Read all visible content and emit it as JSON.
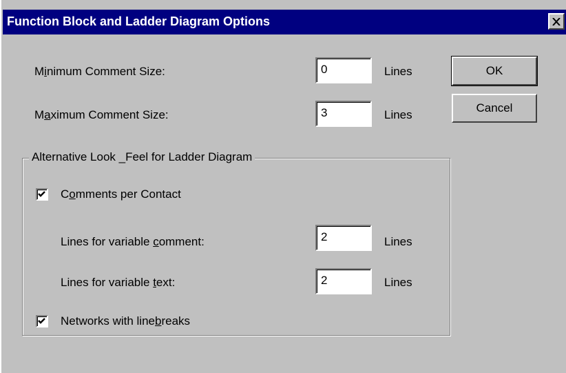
{
  "window": {
    "title": "Function Block and Ladder Diagram Options",
    "close_glyph": "close-icon"
  },
  "comment_size": {
    "min_label_pre": "M",
    "min_label_u": "i",
    "min_label_post": "nimum Comment Size:",
    "min_value": "0",
    "max_label_pre": "M",
    "max_label_u": "a",
    "max_label_post": "ximum Comment Size:",
    "max_value": "3",
    "unit": "Lines"
  },
  "buttons": {
    "ok": "OK",
    "cancel": "Cancel"
  },
  "group": {
    "title": "Alternative Look _Feel for Ladder Diagram",
    "comments_per_contact": {
      "label_pre": "C",
      "label_u": "o",
      "label_post": "mments per Contact",
      "checked": true
    },
    "var_comment": {
      "label_pre": "Lines for variable ",
      "label_u": "c",
      "label_post": "omment:",
      "value": "2",
      "unit": "Lines"
    },
    "var_text": {
      "label_pre": "Lines for variable ",
      "label_u": "t",
      "label_post": "ext:",
      "value": "2",
      "unit": "Lines"
    },
    "networks_linebreaks": {
      "label_pre": "Networks with line",
      "label_u": "b",
      "label_post": "reaks",
      "checked": true
    }
  },
  "colors": {
    "titlebar": "#000080",
    "face": "#c0c0c0"
  }
}
